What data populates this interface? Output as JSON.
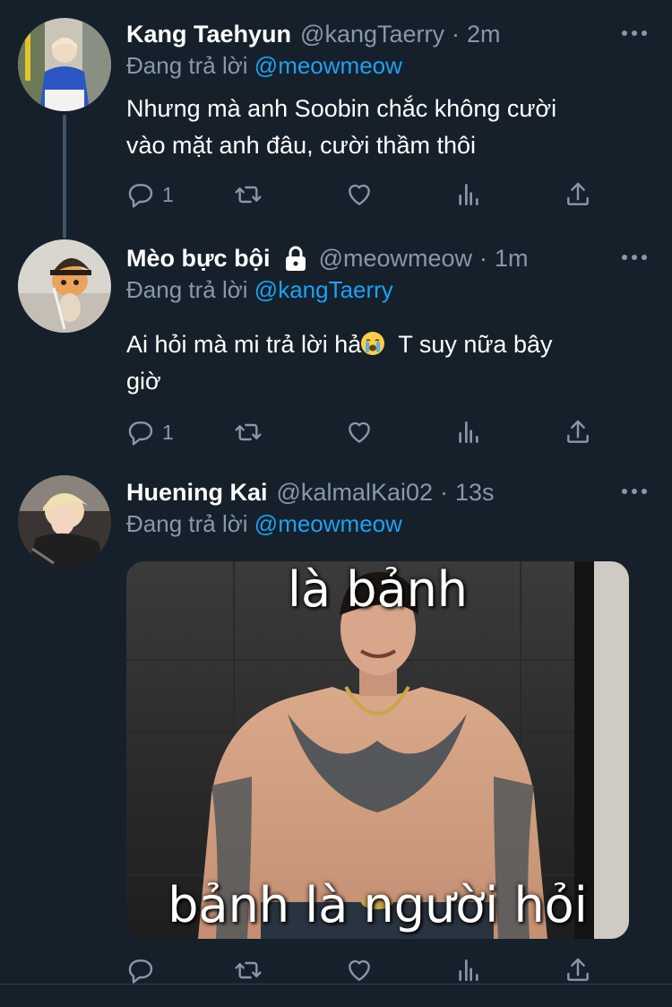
{
  "tweets": [
    {
      "name": "Kang Taehyun",
      "handle": "@kangTaerry",
      "time": "2m",
      "replying_prefix": "Đang trả lời",
      "replying_to": "@meowmeow",
      "text_lines": [
        "Nhưng mà anh Soobin chắc không cười",
        "vào mặt anh đâu, cười thầm thôi"
      ],
      "reply_count": "1"
    },
    {
      "name": "Mèo bực bội",
      "handle": "@meowmeow",
      "time": "1m",
      "protected": true,
      "replying_prefix": "Đang trả lời",
      "replying_to": "@kangTaerry",
      "text_line1": "Ai hỏi mà mi trả lời hả",
      "text_line1_after": "T suy nữa bây",
      "text_line2": "giờ",
      "emoji": "loudly-crying-face",
      "reply_count": "1"
    },
    {
      "name": "Huening Kai",
      "handle": "@kalmalKai02",
      "time": "13s",
      "replying_prefix": "Đang trả lời",
      "replying_to": "@meowmeow",
      "media_caption_top": "là bảnh",
      "media_caption_bottom": "bảnh là người hỏi",
      "reply_count": ""
    }
  ],
  "separator": "·",
  "icons": {
    "reply": "reply-icon",
    "retweet": "retweet-icon",
    "like": "heart-icon",
    "analytics": "analytics-icon",
    "share": "share-icon",
    "more": "more-icon",
    "lock": "lock-icon"
  },
  "colors": {
    "background": "#15202b",
    "secondary_text": "#8899a6",
    "link": "#1da1f2",
    "thread_line": "#3d5466"
  }
}
